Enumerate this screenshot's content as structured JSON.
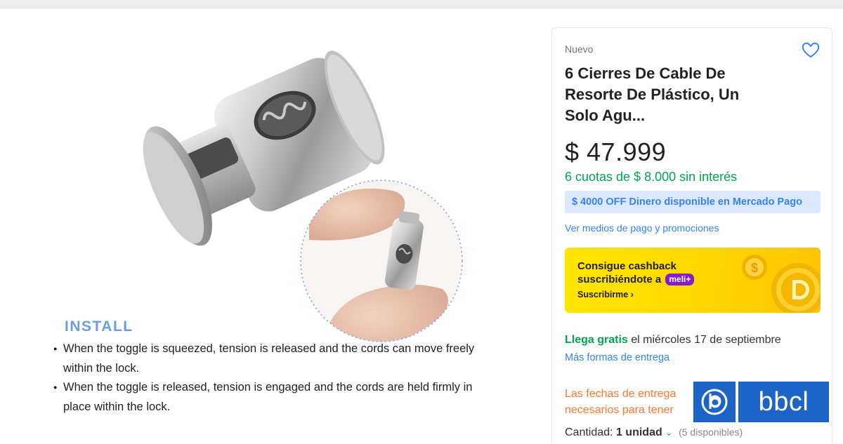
{
  "gallery": {
    "install_title": "INSTALL",
    "bullets": [
      "When the toggle is squeezed, tension is released and the cords can move freely within the lock.",
      "When the toggle is released, tension is engaged and the cords are held firmly in place within the lock."
    ]
  },
  "product": {
    "condition": "Nuevo",
    "title": "6 Cierres De Cable De Resorte De Plástico, Un Solo Agu...",
    "price": "$ 47.999",
    "installments": "6 cuotas de $ 8.000 sin interés",
    "promo": "$ 4000 OFF Dinero disponible en Mercado Pago",
    "payment_link": "Ver medios de pago y promociones",
    "favorite_icon": "heart-icon"
  },
  "cashback": {
    "line1": "Consigue cashback",
    "line2": "suscribiéndote a",
    "badge": "meli+",
    "cta": "Suscribirme",
    "cta_icon": "chevron-right-icon"
  },
  "shipping": {
    "free_label": "Llega gratis",
    "date_text": " el miércoles 17 de septiembre",
    "more_link": "Más formas de entrega"
  },
  "warning": {
    "line1": "Las fechas de entrega",
    "line2": "necesarios para tener"
  },
  "quantity": {
    "label": "Cantidad:",
    "value": "1 unidad",
    "available": "(5 disponibles)"
  },
  "watermark": {
    "text": "bbcl"
  },
  "colors": {
    "accent_blue": "#3483fa",
    "green": "#00a650",
    "orange": "#ff7733",
    "cashback_yellow": "#ffe600",
    "meli_purple": "#8b1ac7",
    "watermark_blue": "#1c64c6"
  }
}
